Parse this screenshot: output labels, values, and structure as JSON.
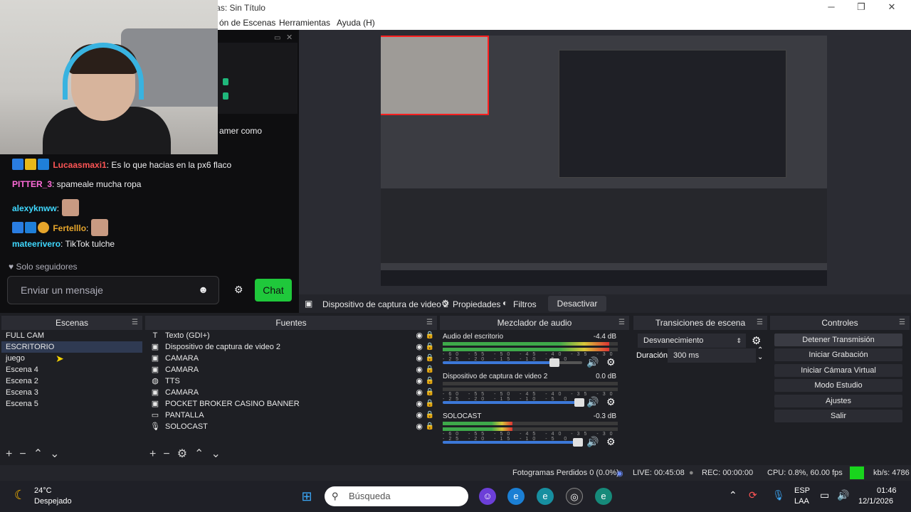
{
  "window": {
    "title": ") - Perfil: Sin Título - Escenas: Sin Título",
    "minimize": "─",
    "restore": "❐",
    "close": "✕"
  },
  "menu": [
    "ón de Escenas",
    "Herramientas",
    "Ayuda (H)"
  ],
  "chat": {
    "partial_line": "amer como",
    "messages": [
      {
        "user": "Lucaasmaxi1",
        "user_color": "#ff5555",
        "text": ": Es lo que hacias en la px6 flaco"
      },
      {
        "user": "PITTER_3",
        "user_color": "#ff6bd9",
        "text": ": spameale mucha ropa"
      },
      {
        "user": "alexyknww",
        "user_color": "#3fd8ff",
        "text": ":"
      },
      {
        "user": "Fertelllo",
        "user_color": "#e6a52b",
        "text": ":"
      },
      {
        "user": "mateerivero",
        "user_color": "#3fd8ff",
        "text": ": TikTok tulche"
      }
    ],
    "followers_only": "Solo seguidores",
    "input_placeholder": "Enviar un mensaje",
    "chat_button": "Chat"
  },
  "source_toolbar": {
    "source_name": "Dispositivo de captura de video 2",
    "properties": "Propiedades",
    "filters": "Filtros",
    "deactivate": "Desactivar"
  },
  "scenes": {
    "title": "Escenas",
    "items": [
      "FULL CAM",
      "ESCRITORIO",
      "juego",
      "Escena 4",
      "Escena 2",
      "Escena 3",
      "Escena 5"
    ],
    "selected_index": 1
  },
  "sources": {
    "title": "Fuentes",
    "items": [
      {
        "icon": "text-icon",
        "glyph": "T",
        "label": "Texto (GDI+)"
      },
      {
        "icon": "camera-icon",
        "glyph": "▣",
        "label": "Dispositivo de captura de video 2"
      },
      {
        "icon": "camera-icon",
        "glyph": "▣",
        "label": "CAMARA"
      },
      {
        "icon": "camera-icon",
        "glyph": "▣",
        "label": "CAMARA"
      },
      {
        "icon": "globe-icon",
        "glyph": "◍",
        "label": "TTS"
      },
      {
        "icon": "camera-icon",
        "glyph": "▣",
        "label": "CAMARA"
      },
      {
        "icon": "camera-icon",
        "glyph": "▣",
        "label": "POCKET BROKER CASINO BANNER"
      },
      {
        "icon": "monitor-icon",
        "glyph": "▭",
        "label": "PANTALLA"
      },
      {
        "icon": "microphone-icon",
        "glyph": "🎙",
        "label": "SOLOCAST"
      }
    ]
  },
  "mixer": {
    "title": "Mezclador de audio",
    "scale": "-60 -55 -50 -45 -40 -35 -30 -25 -20 -15 -10 -5 0",
    "channels": [
      {
        "name": "Audio del escritorio",
        "db": "-4.4 dB",
        "level": 0.95,
        "volume": 0.8
      },
      {
        "name": "Dispositivo de captura de video 2",
        "db": "0.0 dB",
        "level": 0.0,
        "volume": 0.98
      },
      {
        "name": "SOLOCAST",
        "db": "-0.3 dB",
        "level": 0.4,
        "volume": 0.97
      }
    ]
  },
  "transitions": {
    "title": "Transiciones de escena",
    "type": "Desvanecimiento",
    "duration_label": "Duración",
    "duration_value": "300 ms"
  },
  "controls": {
    "title": "Controles",
    "buttons": [
      "Detener Transmisión",
      "Iniciar Grabación",
      "Iniciar Cámara Virtual",
      "Modo Estudio",
      "Ajustes",
      "Salir"
    ]
  },
  "status": {
    "dropped": "Fotogramas Perdidos 0 (0.0%)",
    "live": "LIVE: 00:45:08",
    "rec": "REC: 00:00:00",
    "cpu": "CPU: 0.8%, 60.00 fps",
    "kbps": "kb/s: 4786"
  },
  "taskbar": {
    "weather_temp": "24°C",
    "weather_desc": "Despejado",
    "search": "Búsqueda",
    "lang1": "ESP",
    "lang2": "LAA",
    "time": "01:46",
    "date": "12/1/2026"
  },
  "colors": {
    "accent_green": "#1fc83b",
    "selection": "#2f3a52",
    "live_indicator": "#19d41d"
  }
}
